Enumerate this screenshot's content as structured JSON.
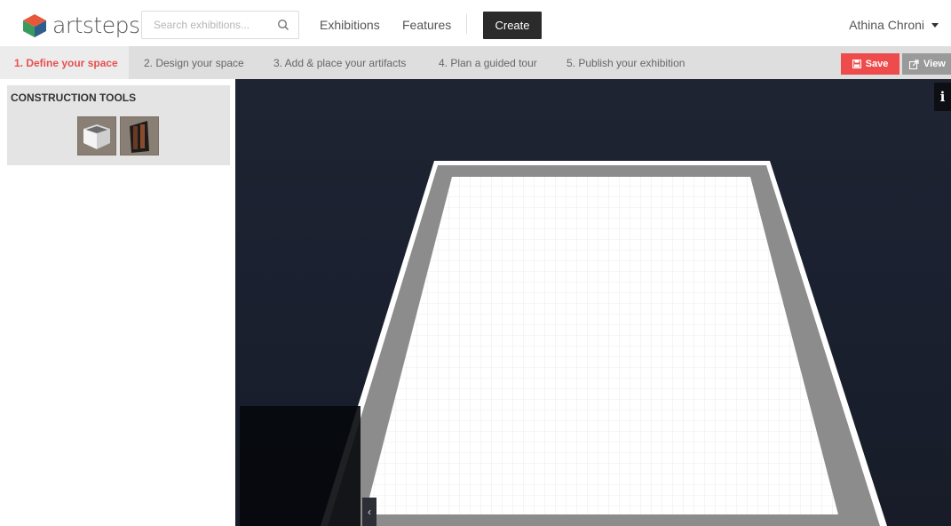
{
  "brand": {
    "name": "artsteps"
  },
  "search": {
    "placeholder": "Search exhibitions..."
  },
  "nav": {
    "exhibitions": "Exhibitions",
    "features": "Features",
    "create": "Create"
  },
  "user": {
    "name": "Athina Chroni"
  },
  "steps": [
    {
      "label": "1. Define your space",
      "active": true
    },
    {
      "label": "2. Design your space",
      "active": false
    },
    {
      "label": "3. Add & place your artifacts",
      "active": false
    },
    {
      "label": "4. Plan a guided tour",
      "active": false
    },
    {
      "label": "5. Publish your exhibition",
      "active": false
    }
  ],
  "actions": {
    "save": "Save",
    "view": "View"
  },
  "panel": {
    "title": "CONSTRUCTION TOOLS",
    "tools": [
      {
        "name": "room",
        "icon": "room-icon"
      },
      {
        "name": "door",
        "icon": "door-icon"
      }
    ]
  },
  "viewport": {
    "info": "i",
    "minimap_toggle": "‹"
  },
  "colors": {
    "accent": "#e85050",
    "save": "#ee4c4c",
    "dark": "#2b2b2b",
    "viewport_bg": "#1c2230",
    "floor_border": "#8c8c8c"
  }
}
